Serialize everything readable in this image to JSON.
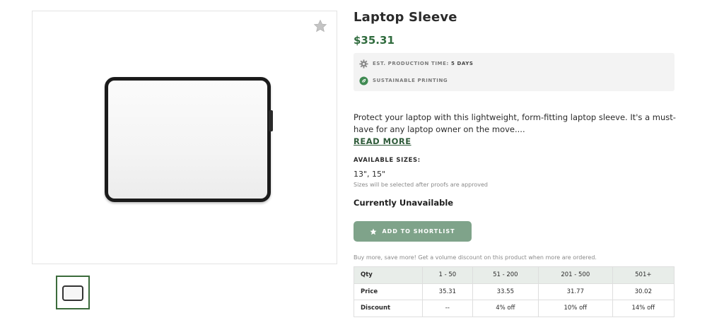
{
  "product": {
    "title": "Laptop Sleeve",
    "price": "$35.31",
    "colors": {
      "accent": "#2f6b3d",
      "button": "#7fa38a",
      "table_header": "#e8ede9"
    }
  },
  "info": {
    "production_label": "EST. PRODUCTION TIME:",
    "production_value": "5 DAYS",
    "production_icon": "gear-icon",
    "sustainable_label": "SUSTAINABLE PRINTING",
    "sustainable_icon": "leaf-icon"
  },
  "description": {
    "text": "Protect your laptop with this lightweight, form-fitting laptop sleeve. It's a must-have for any laptop owner on the move....",
    "read_more": "READ MORE"
  },
  "sizes": {
    "label": "AVAILABLE SIZES:",
    "value": "13\", 15\"",
    "note": "Sizes will be selected after proofs are approved"
  },
  "availability": "Currently Unavailable",
  "shortlist_button": {
    "label": "ADD TO SHORTLIST",
    "icon": "star-icon"
  },
  "volume_note": "Buy more, save more! Get a volume discount on this product when more are ordered.",
  "pricing_table": {
    "header": [
      "Qty",
      "1 - 50",
      "51 - 200",
      "201 - 500",
      "501+"
    ],
    "rows": [
      [
        "Price",
        "35.31",
        "33.55",
        "31.77",
        "30.02"
      ],
      [
        "Discount",
        "--",
        "4% off",
        "10% off",
        "14% off"
      ]
    ]
  }
}
